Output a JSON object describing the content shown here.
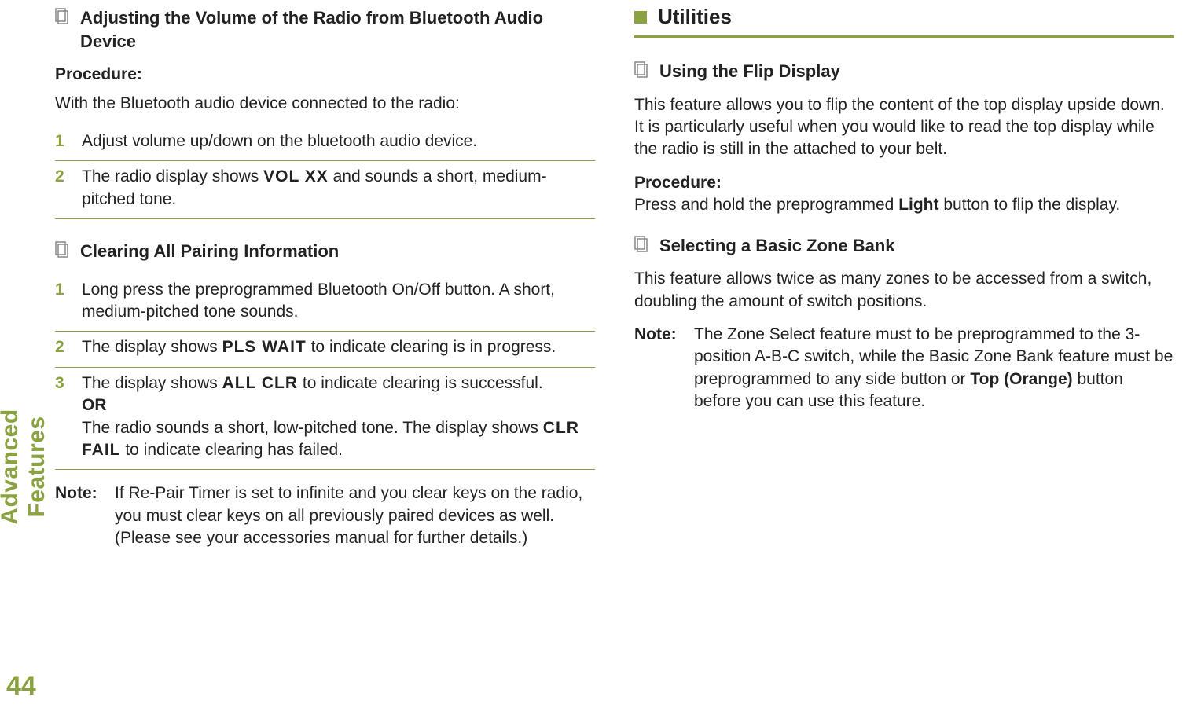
{
  "sidebar": {
    "label": "Advanced Features",
    "pageNumber": "44"
  },
  "left": {
    "topic1": {
      "title": "Adjusting the Volume of the Radio from Bluetooth Audio Device",
      "procLabel": "Procedure:",
      "intro": "With the Bluetooth audio device connected to the radio:",
      "step1": {
        "num": "1",
        "text": "Adjust volume up/down on the bluetooth audio device."
      },
      "step2": {
        "num": "2",
        "pre": "The radio display shows ",
        "lcd": "VOL XX",
        "post": " and sounds a short, medium-pitched tone."
      }
    },
    "topic2": {
      "title": "Clearing All Pairing Information",
      "step1": {
        "num": "1",
        "text": "Long press the preprogrammed Bluetooth On/Off button. A short, medium-pitched tone sounds."
      },
      "step2": {
        "num": "2",
        "pre": "The display shows ",
        "lcd": "PLS WAIT",
        "post": " to indicate clearing is in progress."
      },
      "step3": {
        "num": "3",
        "pre": "The display shows ",
        "lcd1": "ALL CLR",
        "mid1": " to indicate clearing is successful.",
        "or": "OR",
        "mid2": "The radio sounds a short, low-pitched tone. The display shows ",
        "lcd2": "CLR FAIL",
        "post": " to indicate clearing has failed."
      },
      "note": {
        "label": "Note:",
        "text": "If Re-Pair Timer is set to infinite and you clear keys on the radio, you must clear keys on all previously paired devices as well. (Please see your accessories manual for further details.)"
      }
    }
  },
  "right": {
    "sectionTitle": "Utilities",
    "topic1": {
      "title": "Using the Flip Display",
      "para": "This feature allows you to flip the content of the top display upside down. It is particularly useful when you would like to read the top display while the radio is still in the attached to your belt.",
      "procLabel": "Procedure:",
      "procPre": "Press and hold the preprogrammed ",
      "procBold": "Light",
      "procPost": " button to flip the display."
    },
    "topic2": {
      "title": "Selecting a Basic Zone Bank",
      "para": "This feature allows twice as many zones to be accessed from a switch, doubling the amount of switch positions.",
      "note": {
        "label": "Note:",
        "pre": "The Zone Select feature must to be preprogrammed to the 3-position A-B-C switch, while the Basic Zone Bank feature must be preprogrammed to any side button or ",
        "bold": "Top (Orange)",
        "post": " button before you can use this feature."
      }
    }
  }
}
